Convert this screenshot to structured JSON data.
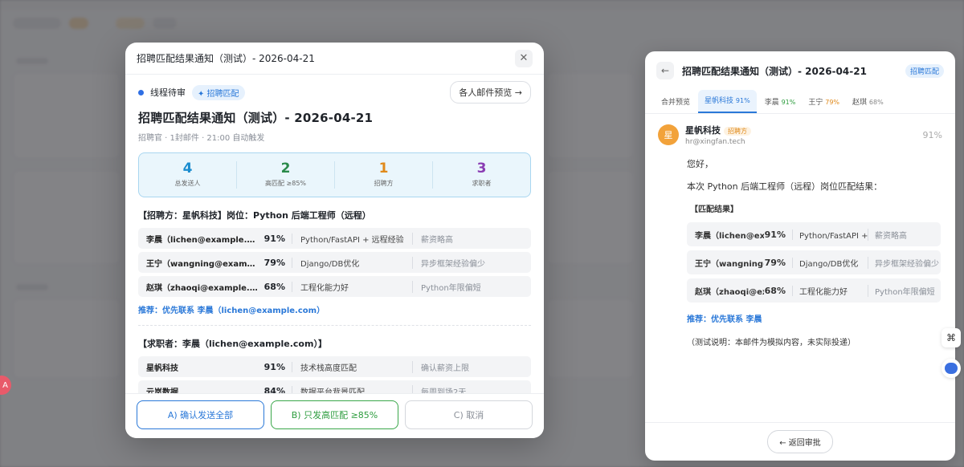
{
  "modal": {
    "window_title": "招聘匹配结果通知（测试）- 2026-04-21",
    "close_icon": "close-icon",
    "status": "线程待审",
    "tag": "✦ 招聘匹配",
    "preview_button": "各人邮件预览 →",
    "title": "招聘匹配结果通知（测试）- 2026-04-21",
    "subline": "招聘官 · 1封邮件 · 21:00 自动触发",
    "stats": [
      {
        "value": "4",
        "label": "总发送人",
        "color": "#1a8ccf"
      },
      {
        "value": "2",
        "label": "高匹配 ≥85%",
        "color": "#2a8a4a"
      },
      {
        "value": "1",
        "label": "招聘方",
        "color": "#e08a1b"
      },
      {
        "value": "3",
        "label": "求职者",
        "color": "#8a3db3"
      }
    ],
    "section1_title": "【招聘方：星帆科技】岗位：Python 后端工程师（远程）",
    "section1_rows": [
      {
        "name": "李晨（lichen@example.com）",
        "pct": "91%",
        "desc": "Python/FastAPI + 远程经验",
        "note": "薪资略高"
      },
      {
        "name": "王宁（wangning@example.com）",
        "pct": "79%",
        "desc": "Django/DB优化",
        "note": "异步框架经验偏少"
      },
      {
        "name": "赵琪（zhaoqi@example.com）",
        "pct": "68%",
        "desc": "工程化能力好",
        "note": "Python年限偏短"
      }
    ],
    "recommend": "推荐：优先联系 李晨（lichen@example.com）",
    "section2_title": "【求职者：李晨（lichen@example.com）】",
    "section2_rows": [
      {
        "name": "星帆科技",
        "pct": "91%",
        "desc": "技术栈高度匹配",
        "note": "确认薪资上限"
      },
      {
        "name": "云岚数据",
        "pct": "84%",
        "desc": "数据平台背景匹配",
        "note": "每周到场2天"
      }
    ],
    "buttons": {
      "a": "A) 确认发送全部",
      "b": "B) 只发高匹配 ≥85%",
      "c": "C) 取消"
    }
  },
  "drawer": {
    "back_icon": "arrow-left-icon",
    "title": "招聘匹配结果通知（测试）- 2026-04-21",
    "tag": "招聘匹配",
    "tabs": [
      {
        "label": "合并预览",
        "pct": "",
        "tone": ""
      },
      {
        "label": "星帆科技",
        "pct": "91%",
        "tone": "g"
      },
      {
        "label": "李晨",
        "pct": "91%",
        "tone": "g"
      },
      {
        "label": "王宁",
        "pct": "79%",
        "tone": "o"
      },
      {
        "label": "赵琪",
        "pct": "68%",
        "tone": "n"
      }
    ],
    "sender": {
      "avatar": "星",
      "name": "星帆科技",
      "role": "招聘方",
      "email": "hr@xingfan.tech",
      "score": "91%"
    },
    "greeting": "您好，",
    "intro": "本次 Python 后端工程师（远程）岗位匹配结果：",
    "result_title": "【匹配结果】",
    "rows": [
      {
        "name": "李晨（lichen@example.com）",
        "pct": "91%",
        "desc": "Python/FastAPI + 远程经验",
        "note": "薪资略高"
      },
      {
        "name": "王宁（wangning@example.com）",
        "pct": "79%",
        "desc": "Django/DB优化",
        "note": "异步框架经验偏少"
      },
      {
        "name": "赵琪（zhaoqi@example.com）",
        "pct": "68%",
        "desc": "工程化能力好",
        "note": "Python年限偏短"
      }
    ],
    "recommend": "推荐：优先联系 李晨",
    "note": "（测试说明：本邮件为模拟内容，未实际投递）",
    "return_button": "← 返回审批"
  },
  "floating": {
    "shortcut_icon": "⌘",
    "assistant_icon": "assistant-icon",
    "left_badge": "A"
  }
}
